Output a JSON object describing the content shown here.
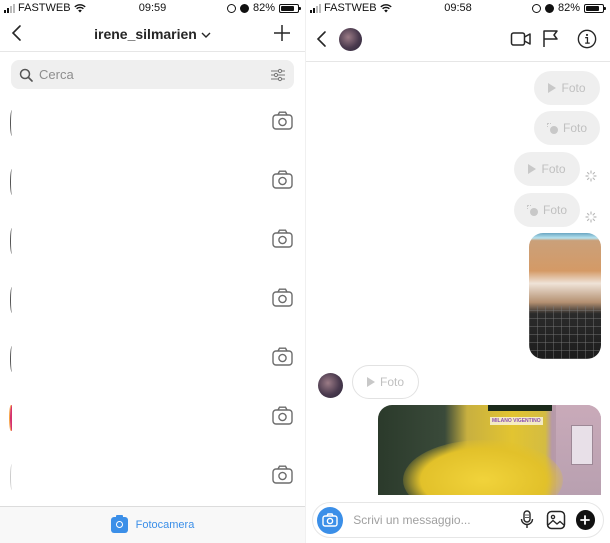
{
  "left": {
    "status": {
      "carrier": "FASTWEB",
      "time": "09:59",
      "battery": "82%"
    },
    "header": {
      "title": "irene_silmarien"
    },
    "search": {
      "placeholder": "Cerca",
      "value": ""
    },
    "conversations": [
      {
        "avatar": "default",
        "icon": "camera-icon"
      },
      {
        "avatar": "default",
        "icon": "camera-icon"
      },
      {
        "avatar": "default",
        "icon": "camera-icon"
      },
      {
        "avatar": "default",
        "icon": "camera-icon"
      },
      {
        "avatar": "default",
        "icon": "camera-icon"
      },
      {
        "avatar": "story-ring",
        "icon": "camera-icon"
      },
      {
        "avatar": "faint",
        "icon": "camera-icon"
      }
    ],
    "footer": {
      "label": "Fotocamera"
    }
  },
  "right": {
    "status": {
      "carrier": "FASTWEB",
      "time": "09:58",
      "battery": "82%"
    },
    "messages": [
      {
        "type": "photo-bubble",
        "icon": "play",
        "label": "Foto",
        "sender": "me",
        "sending": false
      },
      {
        "type": "photo-bubble",
        "icon": "tap",
        "label": "Foto",
        "sender": "me",
        "sending": false
      },
      {
        "type": "photo-bubble",
        "icon": "play",
        "label": "Foto",
        "sender": "me",
        "sending": true
      },
      {
        "type": "photo-bubble",
        "icon": "tap",
        "label": "Foto",
        "sender": "me",
        "sending": true
      },
      {
        "type": "image",
        "subject": "keyboard",
        "sender": "me"
      },
      {
        "type": "photo-bubble",
        "icon": "play",
        "label": "Foto",
        "sender": "other"
      },
      {
        "type": "image",
        "subject": "yellow flowers",
        "caption": "MILANO VIGENTINO",
        "sender": "me"
      }
    ],
    "composer": {
      "placeholder": "Scrivi un messaggio...",
      "value": ""
    }
  },
  "colors": {
    "accent": "#3b8fe8",
    "bubble": "#efefef",
    "text": "#262626",
    "muted": "#8e8e8e"
  }
}
